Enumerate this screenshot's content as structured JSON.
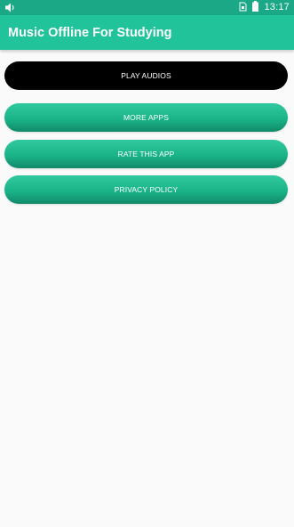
{
  "status_bar": {
    "time": "13:17",
    "icons": [
      "speaker-icon",
      "sim-icon",
      "battery-icon"
    ]
  },
  "toolbar": {
    "title": "Music Offline For Studying"
  },
  "buttons": {
    "play_audios": "PLAY AUDIOS",
    "more_apps": "MORE APPS",
    "rate_app": "RATE THIS APP",
    "privacy_policy": "PRIVACY POLICY"
  },
  "colors": {
    "status_bar": "#1aa886",
    "toolbar": "#21c39a",
    "dark_button": "#000000",
    "green_button": "#1ab488",
    "background": "#fafafa"
  }
}
